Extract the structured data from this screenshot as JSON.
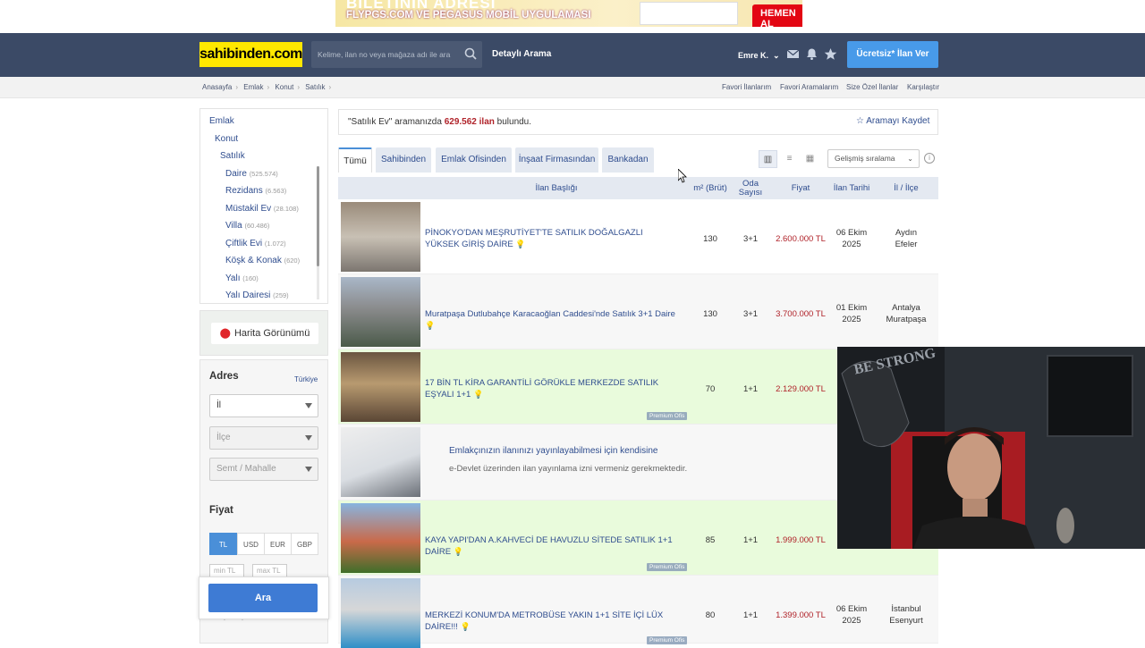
{
  "banner": {
    "line1": "BİLETİNİN ADRESİ",
    "line2": "FLYPGS.COM VE PEGASUS MOBİL UYGULAMASI",
    "cta": "HEMEN AL"
  },
  "nav": {
    "logo": "sahibinden.com",
    "search_placeholder": "Kelime, ilan no veya mağaza adı ile ara",
    "detailed": "Detaylı Arama",
    "user": "Emre K.",
    "post_ad": "Ücretsiz* İlan Ver"
  },
  "breadcrumb": [
    "Anasayfa",
    "Emlak",
    "Konut",
    "Satılık"
  ],
  "toplinks": [
    "Favori İlanlarım",
    "Favori Aramalarım",
    "Size Özel İlanlar",
    "Karşılaştır"
  ],
  "categories": {
    "level1": "Emlak",
    "level2": "Konut",
    "level3": "Satılık",
    "items": [
      {
        "label": "Daire",
        "count": "(525.574)"
      },
      {
        "label": "Rezidans",
        "count": "(6.563)"
      },
      {
        "label": "Müstakil Ev",
        "count": "(28.108)"
      },
      {
        "label": "Villa",
        "count": "(60.486)"
      },
      {
        "label": "Çiftlik Evi",
        "count": "(1.072)"
      },
      {
        "label": "Köşk & Konak",
        "count": "(620)"
      },
      {
        "label": "Yalı",
        "count": "(160)"
      },
      {
        "label": "Yalı Dairesi",
        "count": "(259)"
      }
    ]
  },
  "map_button": "Harita Görünümü",
  "filters": {
    "address_label": "Adres",
    "country": "Türkiye",
    "il": "İl",
    "ilce": "İlçe",
    "semt": "Semt / Mahalle",
    "price_label": "Fiyat",
    "currencies": [
      "TL",
      "USD",
      "EUR",
      "GBP"
    ],
    "min": "min TL",
    "max": "max TL",
    "search_button": "Ara",
    "m2_label": "m² (Brüt)"
  },
  "results": {
    "query": "\"Satılık Ev\"",
    "text_before": "aramanızda",
    "count": "629.562 ilan",
    "text_after": "bulundu.",
    "save": "Aramayı Kaydet"
  },
  "tabs": [
    "Tümü",
    "Sahibinden",
    "Emlak Ofisinden",
    "İnşaat Firmasından",
    "Bankadan"
  ],
  "sort": "Gelişmiş sıralama",
  "table": {
    "headers": {
      "title": "İlan Başlığı",
      "m2": "m² (Brüt)",
      "rooms": "Oda Sayısı",
      "price": "Fiyat",
      "date": "İlan Tarihi",
      "location": "İl / İlçe"
    },
    "rows": [
      {
        "title": "PİNOKYO'DAN MEŞRUTİYET'TE SATILIK DOĞALGAZLI YÜKSEK GİRİŞ DAİRE",
        "m2": "130",
        "rooms": "3+1",
        "price": "2.600.000 TL",
        "date1": "06 Ekim",
        "date2": "2025",
        "loc1": "Aydın",
        "loc2": "Efeler",
        "premium": ""
      },
      {
        "title": "Muratpaşa Dutlubahçe Karacaoğlan Caddesi'nde Satılık 3+1 Daire",
        "m2": "130",
        "rooms": "3+1",
        "price": "3.700.000 TL",
        "date1": "01 Ekim",
        "date2": "2025",
        "loc1": "Antalya",
        "loc2": "Muratpaşa",
        "premium": ""
      },
      {
        "title": "17 BİN TL KİRA GARANTİLİ GÖRÜKLE MERKEZDE SATILIK EŞYALI 1+1",
        "m2": "70",
        "rooms": "1+1",
        "price": "2.129.000 TL",
        "date1": "",
        "date2": "",
        "loc1": "",
        "loc2": "",
        "premium": "Premium Ofis"
      },
      {
        "title": "KAYA YAPI'DAN A.KAHVECİ DE HAVUZLU SİTEDE SATILIK 1+1 DAİRE",
        "m2": "85",
        "rooms": "1+1",
        "price": "1.999.000 TL",
        "date1": "",
        "date2": "",
        "loc1": "",
        "loc2": "",
        "premium": "Premium Ofis"
      },
      {
        "title": "MERKEZİ KONUM'DA METROBÜSE YAKIN 1+1 SİTE İÇİ LÜX DAİRE!!!",
        "m2": "80",
        "rooms": "1+1",
        "price": "1.399.000 TL",
        "date1": "06 Ekim",
        "date2": "2025",
        "loc1": "İstanbul",
        "loc2": "Esenyurt",
        "premium": "Premium Ofis"
      }
    ],
    "notice": {
      "line1": "Emlakçınızın ilanınızı yayınlayabilmesi için kendisine",
      "line2": "e-Devlet üzerinden ilan yayınlama izni vermeniz gerekmektedir."
    }
  },
  "webcam": {
    "shirt_text": "BE STRONG"
  }
}
